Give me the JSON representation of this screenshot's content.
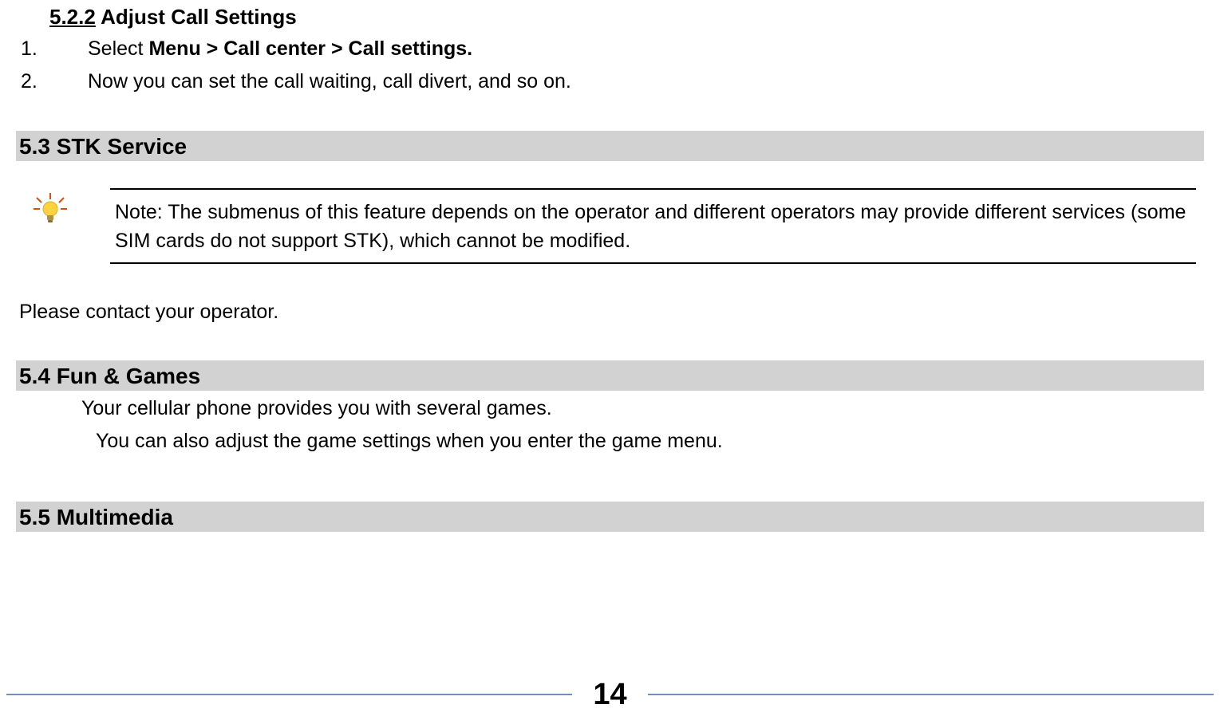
{
  "section522": {
    "num": "5.2.2",
    "title": " Adjust Call Settings",
    "items": [
      {
        "n": "1.",
        "prefix": "Select ",
        "bold": "Menu > Call center > Call settings."
      },
      {
        "n": "2.",
        "text": "Now you can set the call waiting, call divert, and so on."
      }
    ]
  },
  "section53": {
    "title": "5.3 STK Service",
    "note": "Note: The submenus of this feature depends on the operator and different operators may provide different services (some SIM cards do not support STK), which cannot be modified.",
    "body": "Please contact your operator."
  },
  "section54": {
    "title": "5.4 Fun & Games",
    "line1": "Your cellular phone provides you with several games.",
    "line2": "You can also adjust the game settings when you enter the game menu."
  },
  "section55": {
    "title": "5.5 Multimedia"
  },
  "footer": {
    "page": "14"
  },
  "icons": {
    "bulb": "lightbulb-tip-icon"
  }
}
